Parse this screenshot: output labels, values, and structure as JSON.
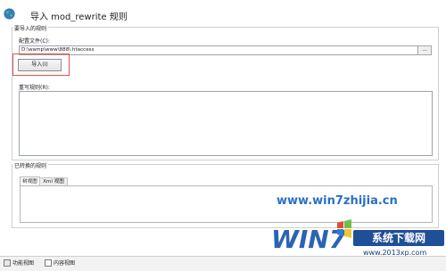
{
  "window": {
    "title": "导入 mod_rewrite 规则"
  },
  "import_group": {
    "legend": "要导入的规则",
    "config_label": "配置文件(C):",
    "config_path": "D:\\wamp\\www\\888\\.htaccess",
    "browse_label": "...",
    "import_button": "导入(I)",
    "rewrite_label": "重写规则(R):",
    "rewrite_text": ""
  },
  "converted_group": {
    "legend": "已转换的规则",
    "tabs": [
      {
        "label": "树视图",
        "active": true
      },
      {
        "label": "Xml 视图",
        "active": false
      }
    ]
  },
  "watermark": {
    "text": "www.win7zhijia.cn"
  },
  "logo": {
    "win7_text": "WIN7",
    "brand": "系统下载网",
    "url": "www.2013xp.com"
  },
  "statusbar": {
    "tabs": [
      "功能视图",
      "内容视图"
    ]
  },
  "colors": {
    "highlight": "#d9534f",
    "watermark": "#2a6fc9",
    "logo_blue": "#1f4f96"
  }
}
